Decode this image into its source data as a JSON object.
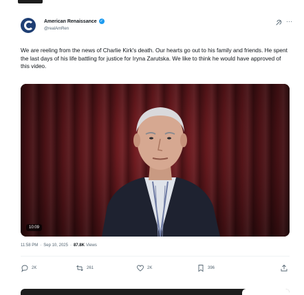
{
  "post": {
    "display_name": "American Renaissance",
    "handle": "@realAmRen",
    "text": "We are reeling from the news of Charlie Kirk's death. Our hearts go out to his family and friends. He spent the last days of his life battling for justice for Iryna Zarutska. We like to think he would have approved of this video.",
    "video_time": "10:09",
    "time": "11:58 PM",
    "date": "Sep 10, 2025",
    "views_count": "87.8K",
    "views_label": "Views"
  },
  "actions": {
    "reply_count": "2K",
    "repost_count": "261",
    "like_count": "2K",
    "bookmark_count": "396"
  },
  "icons": {
    "avatar": "american-renaissance-logo",
    "verified": "verified-badge",
    "grok": "grok-icon",
    "more": "more-icon",
    "reply": "reply-icon",
    "repost": "repost-icon",
    "like": "heart-icon",
    "bookmark": "bookmark-icon",
    "share": "share-icon"
  },
  "colors": {
    "accent": "#1d9bf0",
    "text_primary": "#0f1419",
    "text_secondary": "#536471"
  }
}
